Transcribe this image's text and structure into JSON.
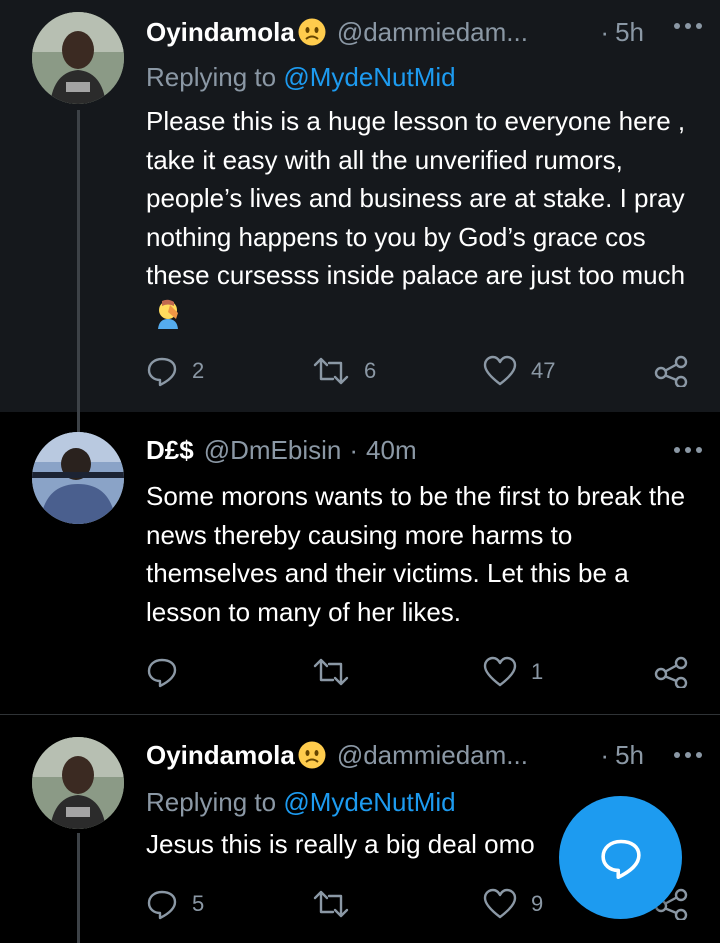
{
  "colors": {
    "accent": "#1d9bf0",
    "muted": "#8b98a5",
    "highlight_bg": "#15181c"
  },
  "tweets": [
    {
      "name": "Oyindamola",
      "name_emoji": "slightly-frowning-face-emoji",
      "handle": "@dammiedam...",
      "separator": "·",
      "time": "5h",
      "reply_prefix": "Replying to ",
      "reply_mention": "@MydeNutMid",
      "text": "Please this is a huge lesson to everyone here , take it easy with all the unverified rumors, people’s lives and business are at stake. I pray nothing happens to you by God’s grace cos these cursesss inside palace are just too much",
      "text_emoji": "face-palm-emoji",
      "replies": "2",
      "retweets": "6",
      "likes": "47"
    },
    {
      "name": "D£$",
      "handle": "@DmEbisin",
      "separator": "·",
      "time": "40m",
      "text": "Some morons wants to be the first to break the news thereby causing more harms to themselves and their victims.  Let this be a lesson to many of her likes.",
      "replies": "",
      "retweets": "",
      "likes": "1"
    },
    {
      "name": "Oyindamola",
      "name_emoji": "slightly-frowning-face-emoji",
      "handle": "@dammiedam...",
      "separator": "·",
      "time": "5h",
      "reply_prefix": "Replying to ",
      "reply_mention": "@MydeNutMid",
      "text": "Jesus this is really a big deal omo",
      "replies": "5",
      "retweets": "",
      "likes": "9"
    }
  ],
  "fab": {
    "icon": "reply-bubble-icon"
  }
}
